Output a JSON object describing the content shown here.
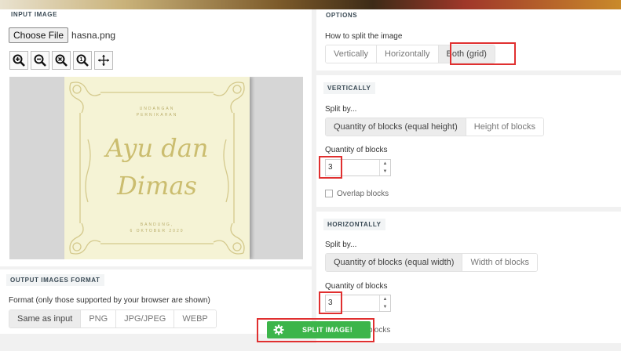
{
  "input": {
    "title": "INPUT IMAGE",
    "choose_label": "Choose File",
    "file_name": "hasna.png",
    "zoom_icons": [
      "zoom-in-icon",
      "zoom-out-icon",
      "zoom-reset-icon",
      "zoom-fit-icon",
      "move-icon"
    ]
  },
  "preview": {
    "line1": "UNDANGAN",
    "line2": "PERNIKAHAN",
    "names1": "Ayu dan",
    "names2": "Dimas",
    "place": "BANDUNG,",
    "date": "6 OKTOBER 2020"
  },
  "output_format": {
    "title": "OUTPUT IMAGES FORMAT",
    "label": "Format (only those supported by your browser are shown)",
    "options": [
      "Same as input",
      "PNG",
      "JPG/JPEG",
      "WEBP"
    ]
  },
  "options": {
    "title": "OPTIONS",
    "how_label": "How to split the image",
    "modes": [
      "Vertically",
      "Horizontally",
      "Both (grid)"
    ]
  },
  "vertically": {
    "title": "VERTICALLY",
    "split_by": "Split by...",
    "modes": [
      "Quantity of blocks (equal height)",
      "Height of blocks"
    ],
    "qty_label": "Quantity of blocks",
    "qty_value": "3",
    "overlap_label": "Overlap blocks"
  },
  "horizontally": {
    "title": "HORIZONTALLY",
    "split_by": "Split by...",
    "modes": [
      "Quantity of blocks (equal width)",
      "Width of blocks"
    ],
    "qty_label": "Quantity of blocks",
    "qty_value": "3",
    "overlap_tail": "blocks"
  },
  "split_button": {
    "label": "SPLIT IMAGE!"
  },
  "colors": {
    "accent_red": "#e03030",
    "green": "#3cb54a"
  }
}
